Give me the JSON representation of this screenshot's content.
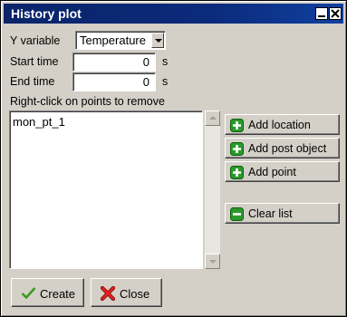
{
  "window": {
    "title": "History plot"
  },
  "yvar": {
    "label": "Y variable",
    "value": "Temperature"
  },
  "start": {
    "label": "Start time",
    "value": "0",
    "unit": "s"
  },
  "end": {
    "label": "End time",
    "value": "0",
    "unit": "s"
  },
  "list": {
    "instruction": "Right-click on points to remove",
    "items": [
      "mon_pt_1"
    ]
  },
  "side_buttons": {
    "add_location": "Add location",
    "add_post_object": "Add post object",
    "add_point": "Add point",
    "clear_list": "Clear list"
  },
  "bottom_buttons": {
    "create": "Create",
    "close": "Close"
  },
  "icons": {
    "add": "plus-icon",
    "clear": "minus-icon",
    "create": "checkmark-icon",
    "close": "x-icon"
  },
  "colors": {
    "titlebar": "#0a246a",
    "add_green": "#2a9a2a",
    "close_red": "#d02020"
  }
}
